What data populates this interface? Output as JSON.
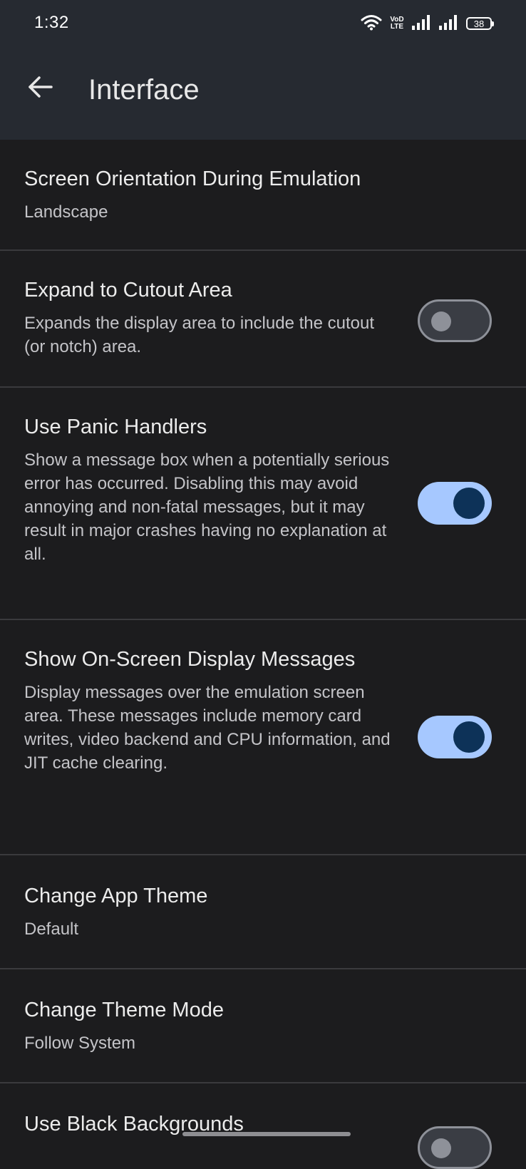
{
  "status_bar": {
    "time": "1:32",
    "battery": "38",
    "volte_top": "VoD",
    "volte_bottom": "LTE",
    "icons": [
      "wifi-icon",
      "volte-icon",
      "signal-icon",
      "signal-icon",
      "battery-icon"
    ]
  },
  "app_bar": {
    "back_icon": "arrow-left-icon",
    "title": "Interface"
  },
  "settings": [
    {
      "title": "Screen Orientation During Emulation",
      "subtitle": "Landscape"
    },
    {
      "title": "Expand to Cutout Area",
      "subtitle": "Expands the display area to include the cutout (or notch) area.",
      "toggle": false
    },
    {
      "title": "Use Panic Handlers",
      "subtitle": "Show a message box when a potentially serious error has occurred. Disabling this may avoid annoying and non-fatal messages, but it may result in major crashes having no explanation at all.",
      "toggle": true
    },
    {
      "title": "Show On-Screen Display Messages",
      "subtitle": "Display messages over the emulation screen area. These messages include memory card writes, video backend and CPU information, and JIT cache clearing.",
      "toggle": true
    },
    {
      "title": "Change App Theme",
      "subtitle": "Default"
    },
    {
      "title": "Change Theme Mode",
      "subtitle": "Follow System"
    },
    {
      "title": "Use Black Backgrounds",
      "toggle": false
    }
  ],
  "colors": {
    "background": "#1c1c1e",
    "app_bar": "#262a31",
    "toggle_on_track": "#a6c8ff",
    "toggle_on_knob": "#0d3258",
    "toggle_off_track": "#3a3d44",
    "toggle_off_outline": "#8e9199",
    "divider": "#3a3a3d"
  }
}
